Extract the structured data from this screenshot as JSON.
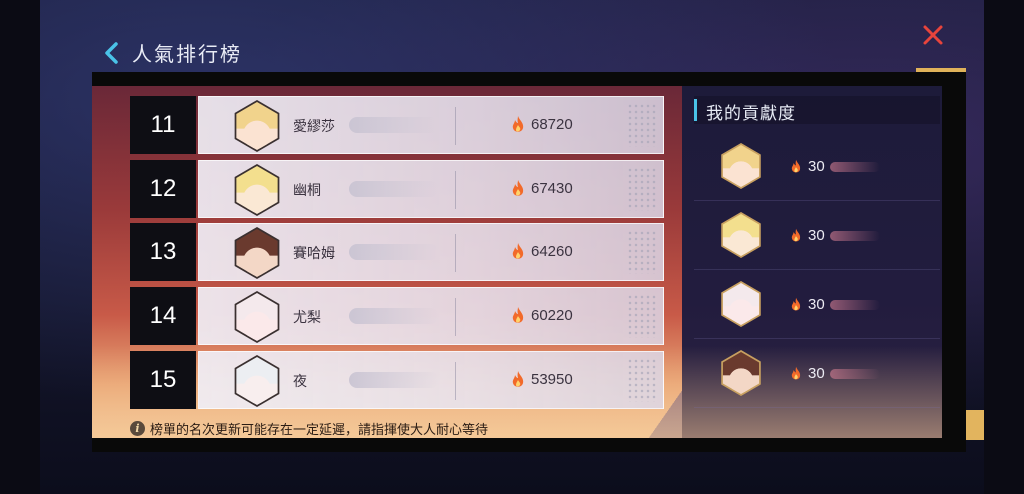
{
  "header": {
    "title": "人氣排行榜"
  },
  "ranking": [
    {
      "rank": "11",
      "name": "愛繆莎",
      "score": "68720",
      "avatar_hair": "#f1d38c",
      "avatar_skin": "#fbe3d2"
    },
    {
      "rank": "12",
      "name": "幽桐",
      "score": "67430",
      "avatar_hair": "#f3df8e",
      "avatar_skin": "#fae8d4"
    },
    {
      "rank": "13",
      "name": "賽哈姆",
      "score": "64260",
      "avatar_hair": "#6a3a2e",
      "avatar_skin": "#f3d7c6"
    },
    {
      "rank": "14",
      "name": "尤梨",
      "score": "60220",
      "avatar_hair": "#f4e9ec",
      "avatar_skin": "#fbe9ea"
    },
    {
      "rank": "15",
      "name": "夜",
      "score": "53950",
      "avatar_hair": "#eceef2",
      "avatar_skin": "#f8eeee"
    }
  ],
  "contribution": {
    "title": "我的貢獻度",
    "entries": [
      {
        "value": "30",
        "avatar_hair": "#f1d38c",
        "avatar_skin": "#fbe3d2"
      },
      {
        "value": "30",
        "avatar_hair": "#f3df8e",
        "avatar_skin": "#fae8d4"
      },
      {
        "value": "30",
        "avatar_hair": "#f4e9ec",
        "avatar_skin": "#fbe9ea"
      },
      {
        "value": "30",
        "avatar_hair": "#6a3a2e",
        "avatar_skin": "#f3d7c6"
      }
    ]
  },
  "notice": {
    "icon": "i",
    "text": "榜單的名次更新可能存在一定延遲，請指揮使大人耐心等待"
  },
  "colors": {
    "accent_cyan": "#4ac3e8",
    "close_red": "#e8443c",
    "fire_orange": "#f26a2a",
    "gold": "#e2b45e"
  }
}
